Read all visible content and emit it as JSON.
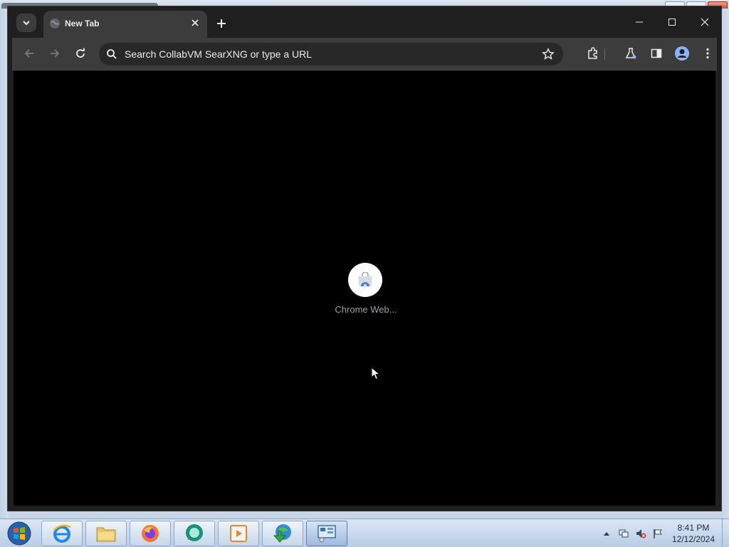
{
  "browser": {
    "tab": {
      "title": "New Tab",
      "favicon": "globe-icon"
    },
    "omnibox": {
      "placeholder": "Search CollabVM SearXNG or type a URL"
    },
    "toolbar_icons": [
      "back-icon",
      "forward-icon",
      "reload-icon",
      "search-icon",
      "star-icon",
      "extensions-icon",
      "labs-flask-icon",
      "side-panel-icon",
      "profile-icon",
      "menu-dots-icon"
    ],
    "window_controls": [
      "minimize-icon",
      "maximize-icon",
      "close-icon"
    ]
  },
  "new_tab_page": {
    "shortcuts": [
      {
        "label": "Chrome Web...",
        "icon": "chrome-web-store-icon"
      }
    ]
  },
  "taskbar": {
    "apps": [
      {
        "name": "Internet Explorer",
        "icon": "internet-explorer-icon"
      },
      {
        "name": "Windows Explorer",
        "icon": "folder-icon"
      },
      {
        "name": "Firefox",
        "icon": "firefox-icon"
      },
      {
        "name": "Chat app",
        "icon": "chat-bubble-icon"
      },
      {
        "name": "Media player",
        "icon": "media-player-icon"
      },
      {
        "name": "Download manager",
        "icon": "globe-download-icon"
      },
      {
        "name": "Control Panel",
        "icon": "control-panel-icon"
      }
    ],
    "clock": {
      "time": "8:41 PM",
      "date": "12/12/2024"
    }
  },
  "colors": {
    "tab_strip": "#1f1f1f",
    "toolbar": "#3c3c3c",
    "omnibox": "#282828",
    "page_background": "#000000",
    "taskbar": "#c7d7ea",
    "profile_accent": "#8ab4f8"
  }
}
